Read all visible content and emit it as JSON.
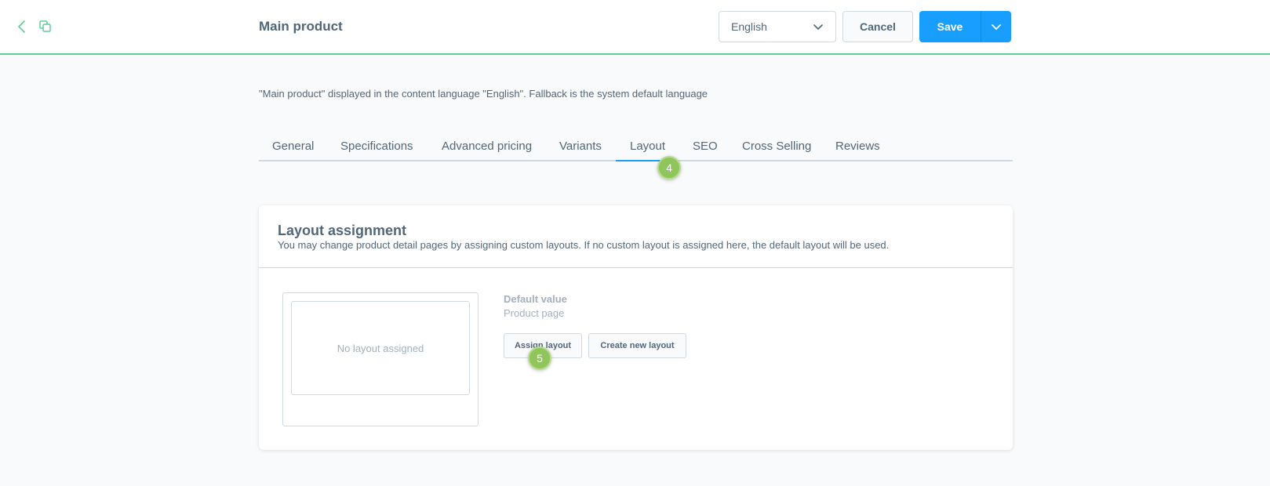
{
  "header": {
    "title": "Main product",
    "language": "English",
    "cancel_label": "Cancel",
    "save_label": "Save"
  },
  "info_text": "\"Main product\" displayed in the content language \"English\". Fallback is the system default language",
  "tabs": [
    {
      "label": "General"
    },
    {
      "label": "Specifications"
    },
    {
      "label": "Advanced pricing"
    },
    {
      "label": "Variants"
    },
    {
      "label": "Layout",
      "active": true
    },
    {
      "label": "SEO"
    },
    {
      "label": "Cross Selling"
    },
    {
      "label": "Reviews"
    }
  ],
  "badges": {
    "tab_step": "4",
    "button_step": "5"
  },
  "layout_card": {
    "title": "Layout assignment",
    "subtitle": "You may change product detail pages by assigning custom layouts. If no custom layout is assigned here, the default layout will be used.",
    "preview_text": "No layout assigned",
    "default_label": "Default value",
    "default_value": "Product page",
    "assign_label": "Assign layout",
    "create_label": "Create new layout"
  },
  "colors": {
    "accent": "#189eff",
    "header_border": "#5ccf97",
    "badge": "#8fc55a"
  }
}
